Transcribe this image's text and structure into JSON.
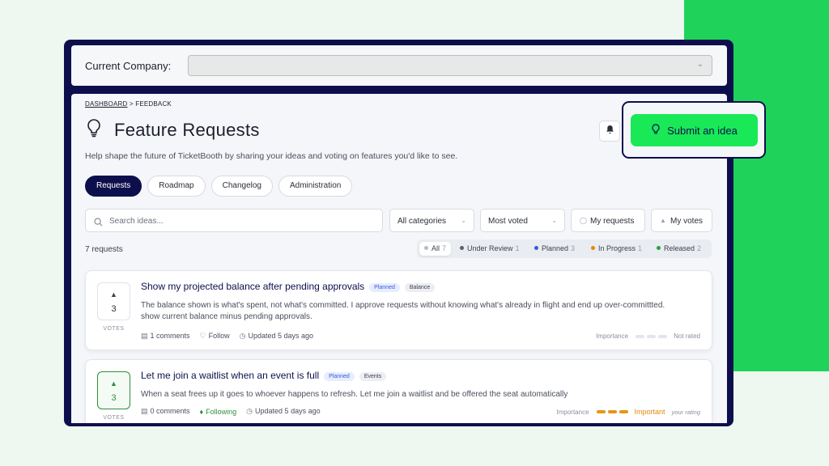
{
  "company": {
    "label": "Current Company:",
    "selected": ""
  },
  "breadcrumb": {
    "root": "DASHBOARD",
    "sep": ">",
    "current": "FEEDBACK"
  },
  "page": {
    "title": "Feature Requests",
    "subtitle": "Help shape the future of TicketBooth by sharing your ideas and voting on features you'd like to see."
  },
  "actions": {
    "submit_label": "Submit an idea"
  },
  "tabs": [
    {
      "label": "Requests",
      "active": true
    },
    {
      "label": "Roadmap",
      "active": false
    },
    {
      "label": "Changelog",
      "active": false
    },
    {
      "label": "Administration",
      "active": false
    }
  ],
  "filters": {
    "search_placeholder": "Search ideas...",
    "category": "All categories",
    "sort": "Most voted",
    "my_requests": "My requests",
    "my_votes": "My votes"
  },
  "list": {
    "count_label": "7 requests",
    "statuses": [
      {
        "label": "All",
        "count": "7",
        "color": "#b5bac3"
      },
      {
        "label": "Under Review",
        "count": "1",
        "color": "#5a5f6b"
      },
      {
        "label": "Planned",
        "count": "3",
        "color": "#3b58d8"
      },
      {
        "label": "In Progress",
        "count": "1",
        "color": "#e08a0c"
      },
      {
        "label": "Released",
        "count": "2",
        "color": "#2f9e44"
      }
    ]
  },
  "requests": [
    {
      "votes": "3",
      "votes_label": "VOTES",
      "title": "Show my projected balance after pending approvals",
      "status_tag": "Planned",
      "category_tag": "Balance",
      "description": "The balance shown is what's spent, not what's committed. I approve requests without knowing what's already in flight and end up over-committted. show current balance minus pending approvals.",
      "comments": "1 comments",
      "follow": "Follow",
      "updated": "Updated 5 days ago",
      "importance_label": "Importance",
      "importance_value": "Not rated",
      "importance_level": 0
    },
    {
      "votes": "3",
      "votes_label": "VOTES",
      "title": "Let me join a waitlist when an event is full",
      "status_tag": "Planned",
      "category_tag": "Events",
      "description": "When a seat frees up it goes to whoever happens to refresh. Let me join a waitlist and be offered the seat automatically",
      "comments": "0 comments",
      "follow": "Following",
      "updated": "Updated 5 days ago",
      "importance_label": "Importance",
      "importance_value": "Important",
      "importance_note": "your rating",
      "importance_level": 3
    }
  ],
  "icons": {
    "title": "lightbulb-icon",
    "bell": "bell-icon",
    "search": "search-icon",
    "comment": "comment-icon",
    "clock": "clock-icon"
  }
}
